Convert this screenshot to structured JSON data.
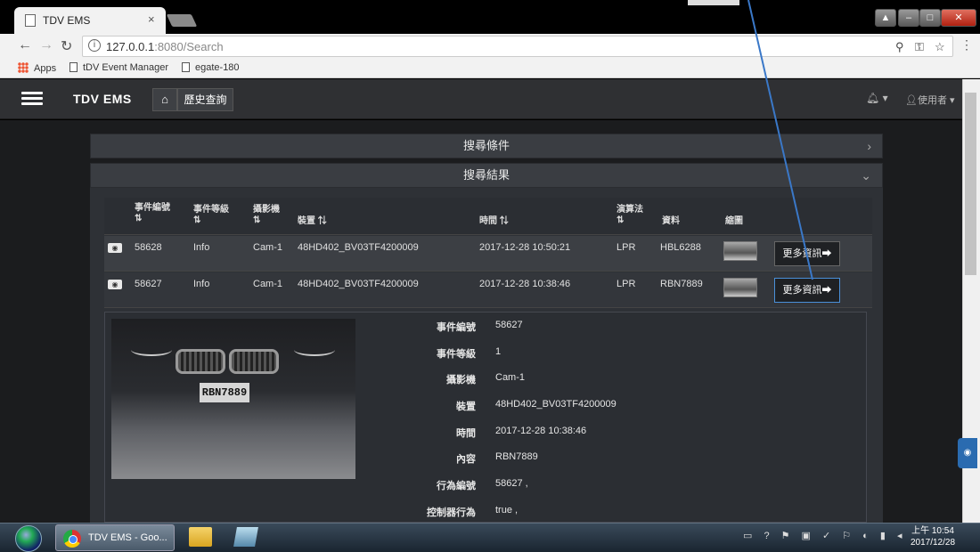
{
  "browser": {
    "tab_title": "TDV EMS",
    "tab_close": "×",
    "url_host": "127.0.0.1",
    "url_rest": ":8080/Search",
    "bookmarks": [
      {
        "label": "Apps"
      },
      {
        "label": "tDV Event Manager"
      },
      {
        "label": "egate-180"
      }
    ]
  },
  "app": {
    "brand": "TDV EMS",
    "breadcrumb": "歷史查詢",
    "user_label": "使用者",
    "user_caret": "▾",
    "bell_caret": "▾"
  },
  "panels": {
    "search_conditions": "搜尋條件",
    "search_results": "搜尋結果"
  },
  "table": {
    "headers": {
      "event_id": "事件編號",
      "event_level": "事件等級",
      "camera": "攝影機",
      "device": "裝置",
      "time": "時間",
      "algorithm": "演算法",
      "data": "資料",
      "thumbnail": "縮圖",
      "sort_glyph": "⇅"
    },
    "rows": [
      {
        "event_id": "58628",
        "level": "Info",
        "camera": "Cam-1",
        "device": "48HD402_BV03TF4200009",
        "time": "2017-12-28 10:50:21",
        "algorithm": "LPR",
        "data": "HBL6288",
        "more": "更多資訊➡"
      },
      {
        "event_id": "58627",
        "level": "Info",
        "camera": "Cam-1",
        "device": "48HD402_BV03TF4200009",
        "time": "2017-12-28 10:38:46",
        "algorithm": "LPR",
        "data": "RBN7889",
        "more": "更多資訊➡"
      }
    ]
  },
  "detail": {
    "plate_text": "RBN7889",
    "fields": [
      {
        "label": "事件編號",
        "value": "58627"
      },
      {
        "label": "事件等級",
        "value": "1"
      },
      {
        "label": "攝影機",
        "value": "Cam-1"
      },
      {
        "label": "裝置",
        "value": "48HD402_BV03TF4200009"
      },
      {
        "label": "時間",
        "value": "2017-12-28 10:38:46"
      },
      {
        "label": "內容",
        "value": "RBN7889"
      },
      {
        "label": "行為編號",
        "value": "58627 ,"
      },
      {
        "label": "控制器行為",
        "value": "true ,"
      }
    ]
  },
  "taskbar": {
    "chrome_label": "TDV EMS - Goo...",
    "clock_time": "上午 10:54",
    "clock_date": "2017/12/28"
  },
  "colors": {
    "accent_line": "#3a78c8",
    "navbar": "#2f3033",
    "panel": "#3a3d42"
  }
}
